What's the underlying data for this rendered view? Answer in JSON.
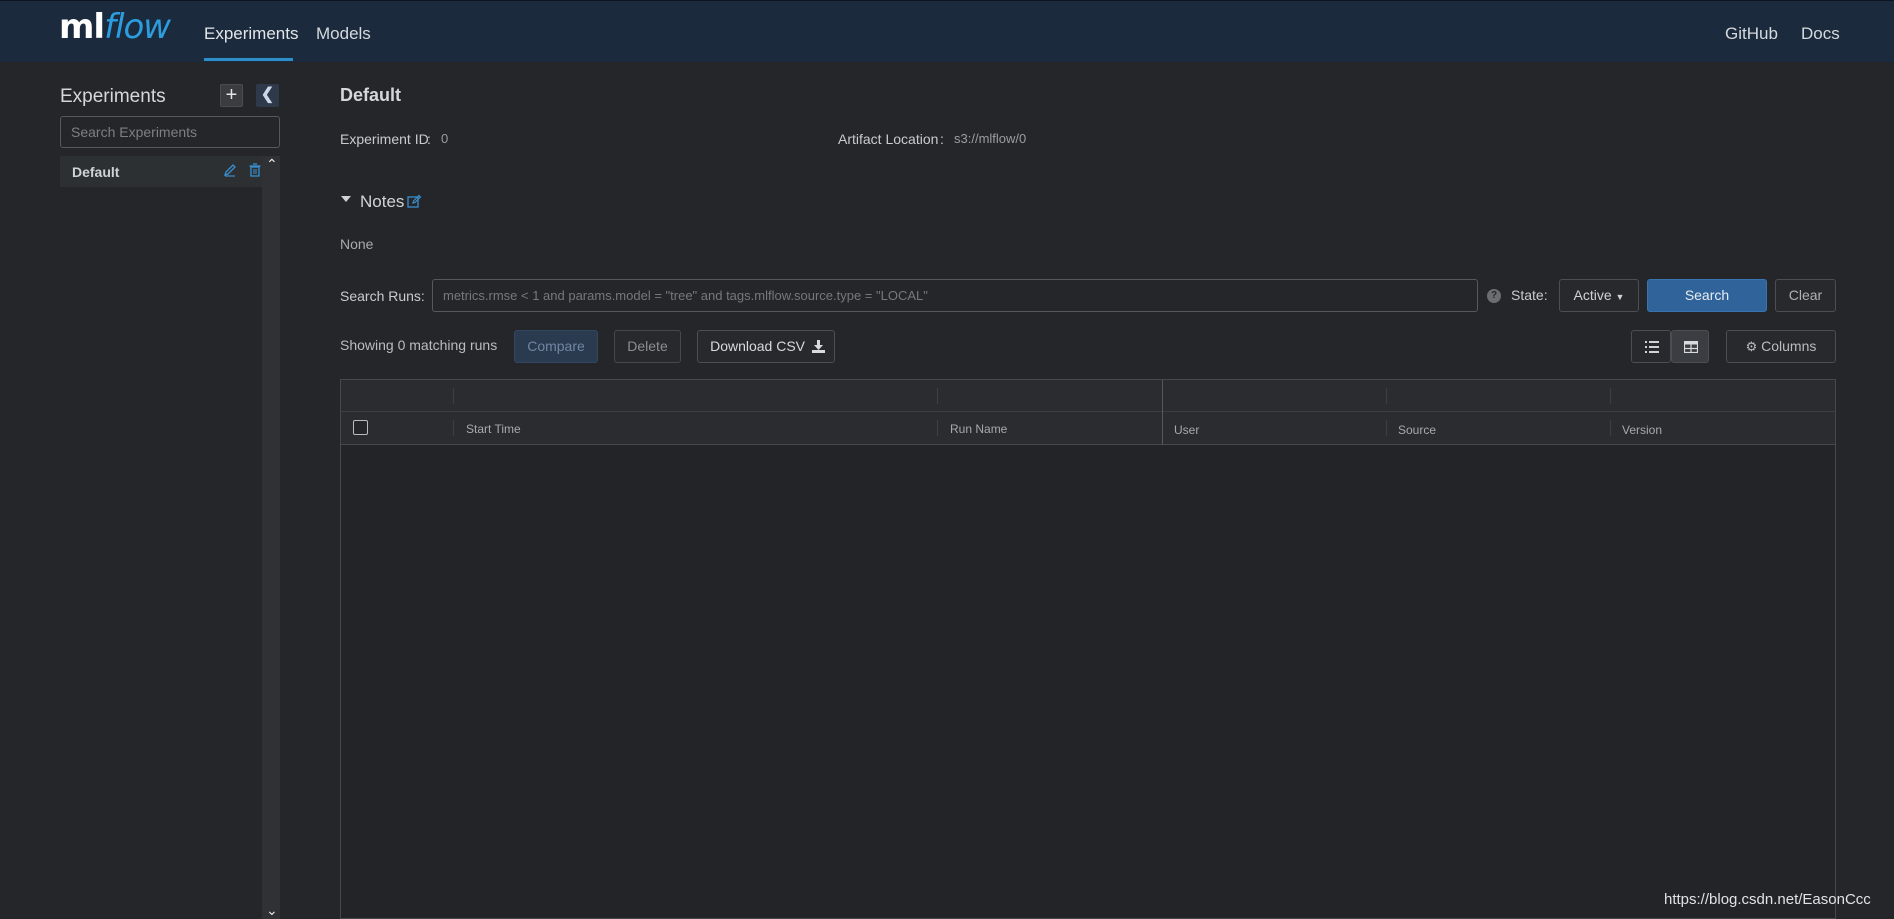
{
  "header": {
    "logo_ml": "ml",
    "logo_flow": "flow",
    "nav": [
      "Experiments",
      "Models"
    ],
    "active_nav": "Experiments",
    "links": [
      "GitHub",
      "Docs"
    ]
  },
  "sidebar": {
    "title": "Experiments",
    "add_label": "+",
    "search_placeholder": "Search Experiments",
    "items": [
      {
        "label": "Default"
      }
    ]
  },
  "experiment": {
    "title": "Default",
    "id_label": "Experiment ID",
    "id_value": "0",
    "artifact_label": "Artifact Location",
    "artifact_value": "s3://mlflow/0",
    "notes_label": "Notes",
    "notes_value": "None"
  },
  "search": {
    "label": "Search Runs:",
    "placeholder": "metrics.rmse < 1 and params.model = \"tree\" and tags.mlflow.source.type = \"LOCAL\"",
    "help": "?",
    "state_label": "State:",
    "state_value": "Active",
    "search_button": "Search",
    "clear_button": "Clear"
  },
  "runs": {
    "showing": "Showing 0 matching runs",
    "compare_button": "Compare",
    "delete_button": "Delete",
    "download_button": "Download CSV",
    "columns_button": "Columns",
    "columns": [
      "Start Time",
      "Run Name",
      "User",
      "Source",
      "Version"
    ],
    "rows": []
  },
  "watermark": "https://blog.csdn.net/EasonCcc",
  "colors": {
    "header_bg": "#1b2a3d",
    "accent": "#2c9ee0",
    "primary_button": "#2f6399",
    "page_bg": "#252629"
  }
}
